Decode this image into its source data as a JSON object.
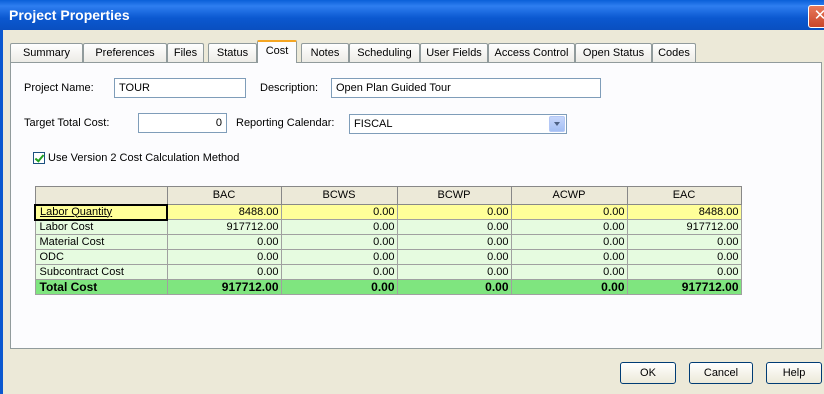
{
  "window": {
    "title": "Project Properties",
    "close_glyph": "✕"
  },
  "tabs": [
    {
      "label": "Summary"
    },
    {
      "label": "Preferences"
    },
    {
      "label": "Files"
    },
    {
      "label": "Status"
    },
    {
      "label": "Cost"
    },
    {
      "label": "Notes"
    },
    {
      "label": "Scheduling"
    },
    {
      "label": "User Fields"
    },
    {
      "label": "Access Control"
    },
    {
      "label": "Open Status"
    },
    {
      "label": "Codes"
    }
  ],
  "active_tab": "Cost",
  "form": {
    "project_name_label": "Project Name:",
    "project_name_value": "TOUR",
    "description_label": "Description:",
    "description_value": "Open Plan Guided Tour",
    "target_total_cost_label": "Target Total Cost:",
    "target_total_cost_value": "0",
    "reporting_calendar_label": "Reporting Calendar:",
    "reporting_calendar_value": "FISCAL",
    "use_v2_label": "Use Version 2 Cost Calculation Method",
    "use_v2_checked": true
  },
  "grid": {
    "columns": [
      "BAC",
      "BCWS",
      "BCWP",
      "ACWP",
      "EAC"
    ],
    "rows": [
      {
        "label": "Labor Quantity",
        "values": [
          "8488.00",
          "0.00",
          "0.00",
          "0.00",
          "8488.00"
        ]
      },
      {
        "label": "Labor Cost",
        "values": [
          "917712.00",
          "0.00",
          "0.00",
          "0.00",
          "917712.00"
        ]
      },
      {
        "label": "Material Cost",
        "values": [
          "0.00",
          "0.00",
          "0.00",
          "0.00",
          "0.00"
        ]
      },
      {
        "label": "ODC",
        "values": [
          "0.00",
          "0.00",
          "0.00",
          "0.00",
          "0.00"
        ]
      },
      {
        "label": "Subcontract Cost",
        "values": [
          "0.00",
          "0.00",
          "0.00",
          "0.00",
          "0.00"
        ]
      },
      {
        "label": "Total Cost",
        "values": [
          "917712.00",
          "0.00",
          "0.00",
          "0.00",
          "917712.00"
        ]
      }
    ],
    "selected_row": "Labor Quantity"
  },
  "buttons": {
    "ok": "OK",
    "cancel": "Cancel",
    "help": "Help"
  },
  "colors": {
    "titlebar": "#0a5fd8",
    "row_highlight": "#ffff99",
    "cell_bg": "#e6fbe0",
    "total_row": "#7fe57f",
    "tab_active_accent": "#f5a623"
  }
}
